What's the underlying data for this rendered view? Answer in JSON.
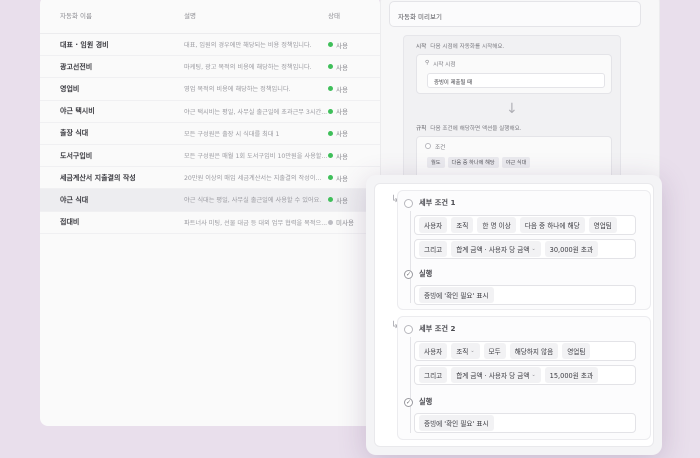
{
  "list": {
    "headers": {
      "name": "자동화 이름",
      "desc": "설명",
      "status": "상태"
    },
    "rows": [
      {
        "name": "대표 · 임원 경비",
        "desc": "대표, 임원의 경우에만 해당되는 비용 정책입니다.",
        "status": "사용",
        "on": true
      },
      {
        "name": "광고선전비",
        "desc": "마케팅, 광고 목적의 비용에 해당하는 정책입니다.",
        "status": "사용",
        "on": true
      },
      {
        "name": "영업비",
        "desc": "영업 목적의 비용에 해당하는 정책입니다.",
        "status": "사용",
        "on": true
      },
      {
        "name": "야근 택시비",
        "desc": "야근 택시비는 평일, 사무실 출근일에 초과근무 3시간...",
        "status": "사용",
        "on": true
      },
      {
        "name": "출장 식대",
        "desc": "모든 구성원은 출장 시 식대를 최대 1",
        "status": "사용",
        "on": true
      },
      {
        "name": "도서구입비",
        "desc": "모든 구성원은 매월 1회 도서구입비 10만원을 사용할...",
        "status": "사용",
        "on": true
      },
      {
        "name": "세금계산서 지출결의 작성",
        "desc": "20만원 이상의 매입 세금계산서는 지출결의 작성이...",
        "status": "사용",
        "on": true
      },
      {
        "name": "야근 식대",
        "desc": "야근 식대는 평일, 사무실 출근일에 사용할 수 있어요.",
        "status": "사용",
        "on": true
      },
      {
        "name": "접대비",
        "desc": "파트너사 미팅, 선물 대금 등 대외 업무 협력을 목적으...",
        "status": "미사용",
        "on": false
      }
    ]
  },
  "preview": {
    "title": "자동화 미리보기",
    "start_label": "시작",
    "start_text": "다음 시점에 자동화를 시작해요.",
    "start_point_label": "시작 시점",
    "start_point_value": "증빙이 제출될 때",
    "rule_label": "규칙",
    "rule_text": "다음 조건에 해당하면 액션을 실행해요.",
    "condition_label": "조건",
    "chips": [
      "월도",
      "다음 중 하나에 해당",
      "야근 식대"
    ]
  },
  "overlay": {
    "sub1": {
      "label": "세부 조건 1",
      "row1": [
        "사용자",
        "조직",
        "한 명 이상",
        "다음 중 하나에 해당",
        "영업팀"
      ],
      "row2": [
        "그리고",
        "합계 금액 · 사용자 당 금액",
        "30,000원 초과"
      ],
      "action_label": "실행",
      "action_value": "증빙에 '확인 필요' 표시"
    },
    "sub2": {
      "label": "세부 조건 2",
      "row1": [
        "사용자",
        "조직",
        "모두",
        "해당하지 않음",
        "영업팀"
      ],
      "row2": [
        "그리고",
        "합계 금액 · 사용자 당 금액",
        "15,000원 초과"
      ],
      "action_label": "실행",
      "action_value": "증빙에 '확인 필요' 표시"
    }
  },
  "colors": {
    "background": "#e9dfec",
    "status_on": "#3fbf5a",
    "status_off": "#bdbdc3"
  }
}
